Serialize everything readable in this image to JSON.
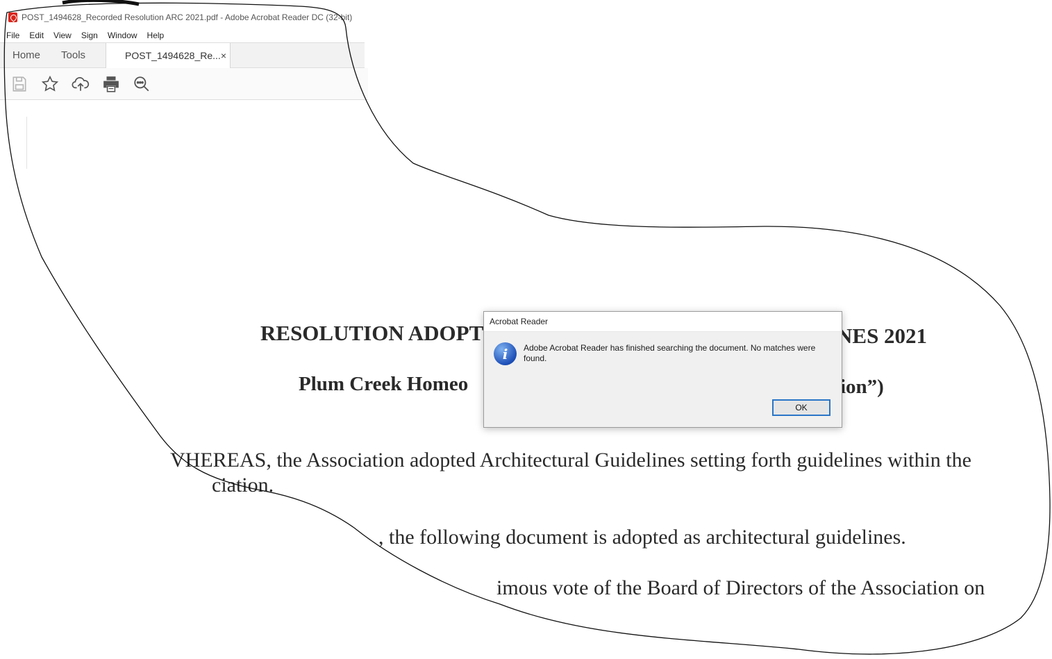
{
  "window": {
    "title": "POST_1494628_Recorded Resolution ARC 2021.pdf - Adobe Acrobat Reader DC (32-bit)"
  },
  "menu": [
    "File",
    "Edit",
    "View",
    "Sign",
    "Window",
    "Help"
  ],
  "tabs": {
    "home": "Home",
    "tools": "Tools",
    "document": "POST_1494628_Re...",
    "close": "×"
  },
  "toolbar": {
    "icons": [
      "save-icon",
      "bookmark-star-icon",
      "upload-cloud-icon",
      "print-icon",
      "find-zoom-icon"
    ]
  },
  "document": {
    "heading1_left": "RESOLUTION ADOPT",
    "heading1_right": "NES 2021",
    "heading2_left": "Plum Creek Homeo",
    "heading2_right": "ion”)",
    "para1_line1": "VHEREAS, the Association adopted Architectural Guidelines setting forth guidelines within the",
    "para1_line2": "ciation.",
    "para2": ", the following document is adopted as architectural guidelines.",
    "para3": "imous vote of the Board of Directors of the Association on"
  },
  "dialog": {
    "title": "Acrobat Reader",
    "message": "Adobe Acrobat Reader has finished searching the document. No matches were\nfound.",
    "ok_label": "OK",
    "icon": "info-icon"
  },
  "colors": {
    "dialog_button_border": "#2a75c7",
    "info_icon": "#1d4fb8",
    "pdf_icon": "#d9261c"
  }
}
